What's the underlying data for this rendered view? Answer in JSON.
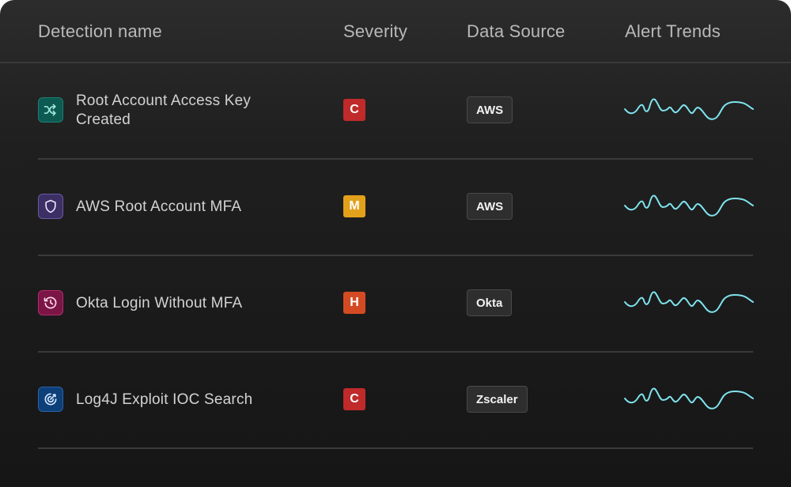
{
  "header": {
    "detection_name": "Detection name",
    "severity": "Severity",
    "data_source": "Data Source",
    "alert_trends": "Alert Trends"
  },
  "rows": [
    {
      "name": "Root Account Access Key Created",
      "icon": "shuffle-icon",
      "icon_bg": "#0d5a52",
      "icon_border": "#1d7f74",
      "icon_color": "#9ee8dc",
      "severity": "C",
      "severity_color": "#c02a2a",
      "source": "AWS"
    },
    {
      "name": "AWS Root Account MFA",
      "icon": "shield-icon",
      "icon_bg": "#3b2f63",
      "icon_border": "#6a5aa8",
      "icon_color": "#e8e2ff",
      "severity": "M",
      "severity_color": "#e3a01b",
      "source": "AWS"
    },
    {
      "name": "Okta Login Without MFA",
      "icon": "history-icon",
      "icon_bg": "#7a1546",
      "icon_border": "#b52a6e",
      "icon_color": "#ffd9ea",
      "severity": "H",
      "severity_color": "#d44b23",
      "source": "Okta"
    },
    {
      "name": "Log4J Exploit IOC Search",
      "icon": "target-icon",
      "icon_bg": "#0d3f78",
      "icon_border": "#2a62a8",
      "icon_color": "#d6e8ff",
      "severity": "C",
      "severity_color": "#c02a2a",
      "source": "Zscaler"
    }
  ],
  "trend_color": "#7fe3ee"
}
